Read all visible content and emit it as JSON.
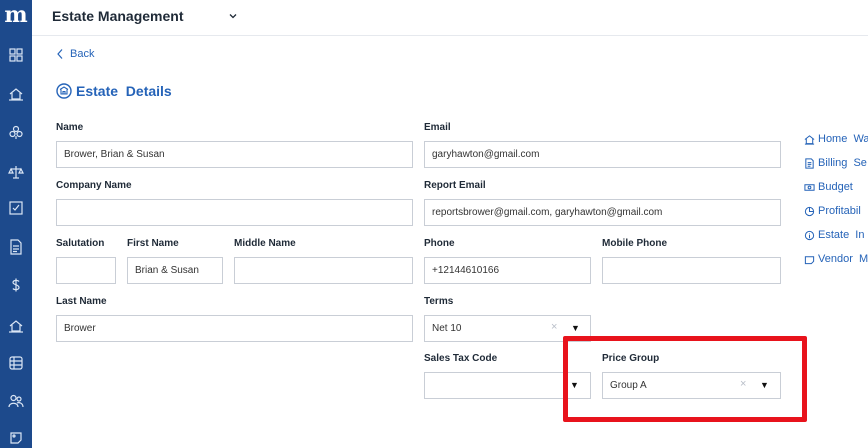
{
  "app": {
    "logo": "m",
    "title": "Estate Management"
  },
  "nav": {
    "back_label": "Back"
  },
  "page": {
    "title": "Estate  Details"
  },
  "form": {
    "name": {
      "label": "Name",
      "value": "Brower, Brian & Susan"
    },
    "company_name": {
      "label": "Company Name",
      "value": ""
    },
    "salutation": {
      "label": "Salutation",
      "value": ""
    },
    "first_name": {
      "label": "First Name",
      "value": "Brian & Susan"
    },
    "middle_name": {
      "label": "Middle Name",
      "value": ""
    },
    "last_name": {
      "label": "Last Name",
      "value": "Brower"
    },
    "email": {
      "label": "Email",
      "value": "garyhawton@gmail.com"
    },
    "report_email": {
      "label": "Report Email",
      "value": "reportsbrower@gmail.com, garyhawton@gmail.com"
    },
    "phone": {
      "label": "Phone",
      "value": "+12144610166"
    },
    "mobile_phone": {
      "label": "Mobile Phone",
      "value": ""
    },
    "terms": {
      "label": "Terms",
      "value": "Net 10"
    },
    "sales_tax_code": {
      "label": "Sales Tax Code",
      "value": ""
    },
    "price_group": {
      "label": "Price Group",
      "value": "Group A"
    }
  },
  "right_links": [
    {
      "label": "Home  Wa",
      "icon": "home-icon"
    },
    {
      "label": "Billing  Se",
      "icon": "document-icon"
    },
    {
      "label": "Budget",
      "icon": "money-icon"
    },
    {
      "label": "Profitabil",
      "icon": "pie-chart-icon"
    },
    {
      "label": "Estate  In",
      "icon": "info-icon"
    },
    {
      "label": "Vendor  M",
      "icon": "tag-icon"
    }
  ],
  "sidebar_icons": [
    "grid-icon",
    "house-icon",
    "flower-icon",
    "balance-icon",
    "checkbox-icon",
    "document-icon",
    "dollar-icon",
    "house-icon",
    "list-icon",
    "people-icon",
    "tag-icon"
  ],
  "colors": {
    "sidebar": "#1d4a8c",
    "accent": "#2563b8",
    "highlight": "#e8131c"
  }
}
